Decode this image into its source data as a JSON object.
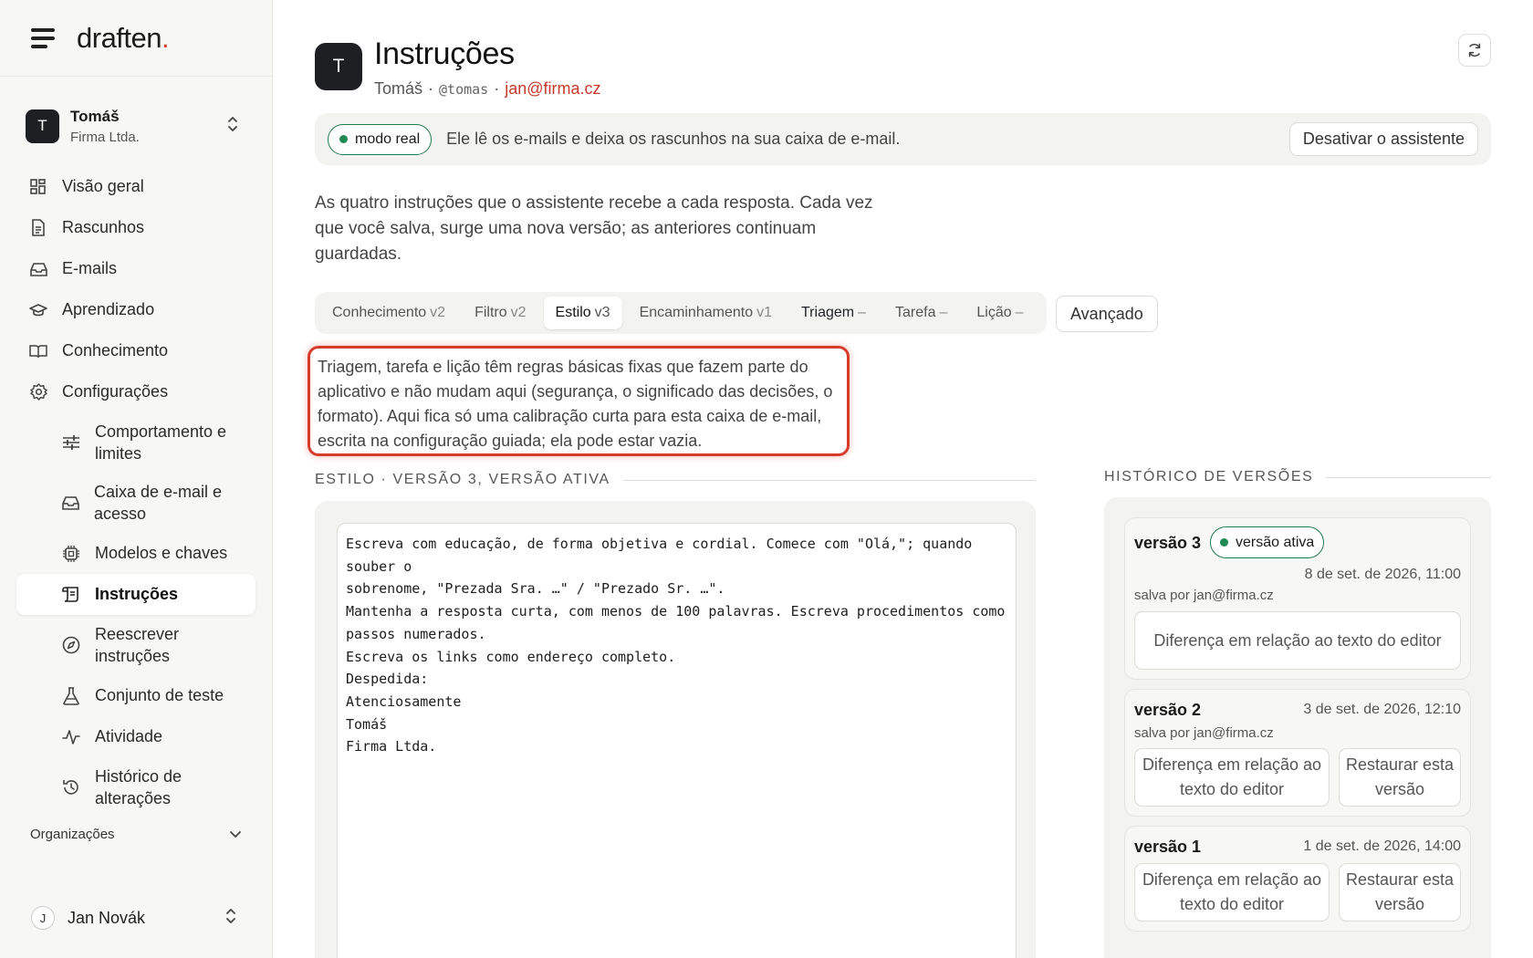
{
  "brand": {
    "name": "draften",
    "dot": "."
  },
  "account": {
    "initial": "T",
    "name": "Tomáš",
    "company": "Firma Ltda."
  },
  "nav": {
    "items": [
      {
        "label": "Visão geral",
        "icon": "grid-icon"
      },
      {
        "label": "Rascunhos",
        "icon": "document-icon"
      },
      {
        "label": "E-mails",
        "icon": "inbox-icon"
      },
      {
        "label": "Aprendizado",
        "icon": "graduation-cap-icon"
      },
      {
        "label": "Conhecimento",
        "icon": "book-icon"
      },
      {
        "label": "Configurações",
        "icon": "gear-icon"
      }
    ],
    "sub_items": [
      {
        "label": "Comportamento e limites",
        "icon": "sliders-icon"
      },
      {
        "label": "Caixa de e-mail e acesso",
        "icon": "inbox-icon"
      },
      {
        "label": "Modelos e chaves",
        "icon": "chip-icon"
      },
      {
        "label": "Instruções",
        "icon": "scroll-icon"
      },
      {
        "label": "Reescrever instruções",
        "icon": "compass-icon"
      },
      {
        "label": "Conjunto de teste",
        "icon": "flask-icon"
      },
      {
        "label": "Atividade",
        "icon": "pulse-icon"
      },
      {
        "label": "Histórico de alterações",
        "icon": "history-icon"
      }
    ],
    "organizations_label": "Organizações"
  },
  "user": {
    "initial": "J",
    "name": "Jan Novák"
  },
  "header": {
    "initial": "T",
    "title": "Instruções",
    "name": "Tomáš",
    "sep1": "·",
    "handle": "@tomas",
    "sep2": "·",
    "email": "jan@firma.cz"
  },
  "banner": {
    "mode_label": "modo real",
    "description": "Ele lê os e-mails e deixa os rascunhos na sua caixa de e-mail.",
    "disable_button": "Desativar o assistente"
  },
  "intro": "As quatro instruções que o assistente recebe a cada resposta. Cada vez que você salva, surge uma nova versão; as anteriores continuam guardadas.",
  "tabs": [
    {
      "label": "Conhecimento",
      "version": "v2"
    },
    {
      "label": "Filtro",
      "version": "v2"
    },
    {
      "label": "Estilo",
      "version": "v3"
    },
    {
      "label": "Encaminhamento",
      "version": "v1"
    },
    {
      "label": "Triagem",
      "version": "–"
    },
    {
      "label": "Tarefa",
      "version": "–"
    },
    {
      "label": "Lição",
      "version": "–"
    }
  ],
  "advanced_button": "Avançado",
  "note": "Triagem, tarefa e lição têm regras básicas fixas que fazem parte do aplicativo e não mudam aqui (segurança, o significado das decisões, o formato). Aqui fica só uma calibração curta para esta caixa de e-mail, escrita na configuração guiada; ela pode estar vazia.",
  "editor": {
    "section_title": "ESTILO · VERSÃO 3, VERSÃO ATIVA",
    "content": "Escreva com educação, de forma objetiva e cordial. Comece com \"Olá,\"; quando souber o\nsobrenome, \"Prezada Sra. …\" / \"Prezado Sr. …\".\nMantenha a resposta curta, com menos de 100 palavras. Escreva procedimentos como\npassos numerados.\nEscreva os links como endereço completo.\nDespedida:\nAtenciosamente\nTomáš\nFirma Ltda."
  },
  "history": {
    "title": "HISTÓRICO DE VERSÕES",
    "versions": [
      {
        "name": "versão 3",
        "badge": "versão ativa",
        "date": "8 de set. de 2026, 11:00",
        "saved_by": "salva por jan@firma.cz",
        "diff_button": "Diferença em relação ao texto do editor"
      },
      {
        "name": "versão 2",
        "date": "3 de set. de 2026, 12:10",
        "saved_by": "salva por jan@firma.cz",
        "diff_button": "Diferença em relação ao texto do editor",
        "restore_button": "Restaurar esta versão"
      },
      {
        "name": "versão 1",
        "date": "1 de set. de 2026, 14:00",
        "diff_button": "Diferença em relação ao texto do editor",
        "restore_button": "Restaurar esta versão"
      }
    ]
  },
  "colors": {
    "accent_red": "#d73b2a",
    "live_green": "#1f8a53",
    "email_red": "#c6392b"
  }
}
